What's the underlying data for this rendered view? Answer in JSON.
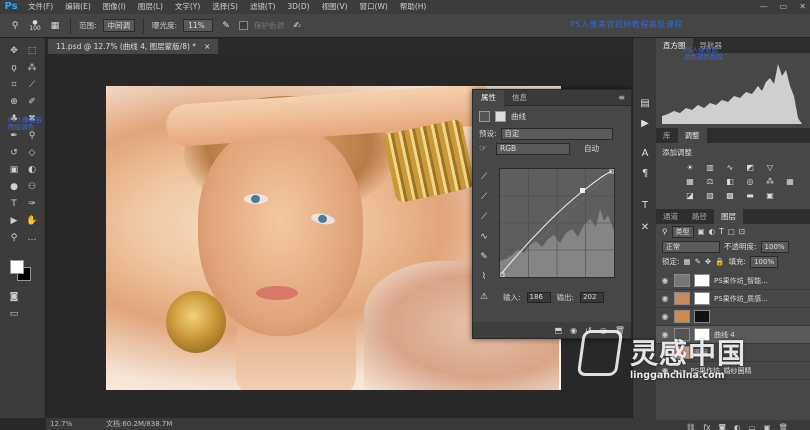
{
  "app": {
    "logo": "Ps"
  },
  "menu": [
    "文件(F)",
    "编辑(E)",
    "图像(I)",
    "图层(L)",
    "文字(Y)",
    "选择(S)",
    "滤镜(T)",
    "3D(D)",
    "视图(V)",
    "窗口(W)",
    "帮助(H)"
  ],
  "window_controls": [
    "—",
    "▭",
    "✕"
  ],
  "options": {
    "brush_size": "100",
    "range_label": "范围:",
    "range_value": "中间调",
    "exposure_label": "曝光度:",
    "exposure_value": "11%",
    "protect_tones": "保护色调",
    "overlay_text": "PS人像美容视频教程高级课程"
  },
  "toolbar": {
    "overlay_text": "PS人像美容\n图层调色"
  },
  "document": {
    "tab_title": "11.psd @ 12.7% (曲线 4, 图层蒙版/8) *",
    "tab_close": "×"
  },
  "properties": {
    "tab_active": "属性",
    "tab_other": "信息",
    "menu_glyph": "≡",
    "title": "曲线",
    "preset_label": "预设:",
    "preset_value": "自定",
    "channel_value": "RGB",
    "auto_label": "自动",
    "input_label": "输入:",
    "input_value": "186",
    "output_label": "输出:",
    "output_value": "202"
  },
  "status": {
    "zoom": "12.7%",
    "doc_info": "文档:60.2M/838.7M"
  },
  "right_panels": {
    "histogram_tab": "直方图",
    "navigator_tab": "导航器",
    "histogram_overlay": "PS人像修图\n润色调色教程",
    "libraries_tab": "库",
    "adjustments_tab": "调整",
    "add_adjustment": "添加调整",
    "channels_tab": "通道",
    "paths_tab": "路径",
    "layers_tab": "图层",
    "kind_label": "类型",
    "blend_mode": "正常",
    "opacity_label": "不透明度:",
    "opacity_value": "100%",
    "lock_label": "锁定:",
    "fill_label": "填充:",
    "fill_value": "100%",
    "layers": [
      {
        "name": "PS果作坊_智能..."
      },
      {
        "name": "PS果作坊_质感..."
      },
      {
        "name": ""
      },
      {
        "name": "曲线 4"
      },
      {
        "name": "图层 1"
      },
      {
        "name": "PS果作坊_婚纱圈精"
      }
    ]
  },
  "watermark": {
    "title": "灵感中国",
    "url": "lingganchina.com"
  }
}
